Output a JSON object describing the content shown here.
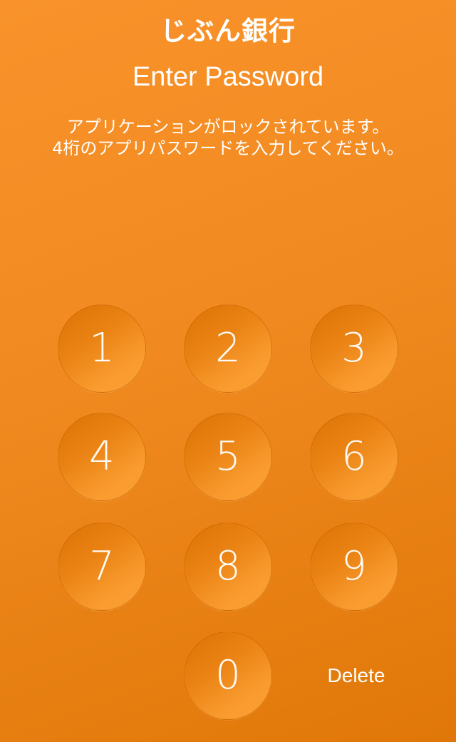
{
  "header": {
    "logo_text": "じぶん銀行",
    "title": "Enter Password",
    "message_line1": "アプリケーションがロックされています。",
    "message_line2": "4桁のアプリパスワードを入力してください。"
  },
  "keypad": {
    "keys": [
      "1",
      "2",
      "3",
      "4",
      "5",
      "6",
      "7",
      "8",
      "9",
      "0"
    ],
    "delete_label": "Delete"
  },
  "colors": {
    "background": "#f08a20",
    "key_fill": "#ea8314",
    "text": "#ffffff"
  }
}
